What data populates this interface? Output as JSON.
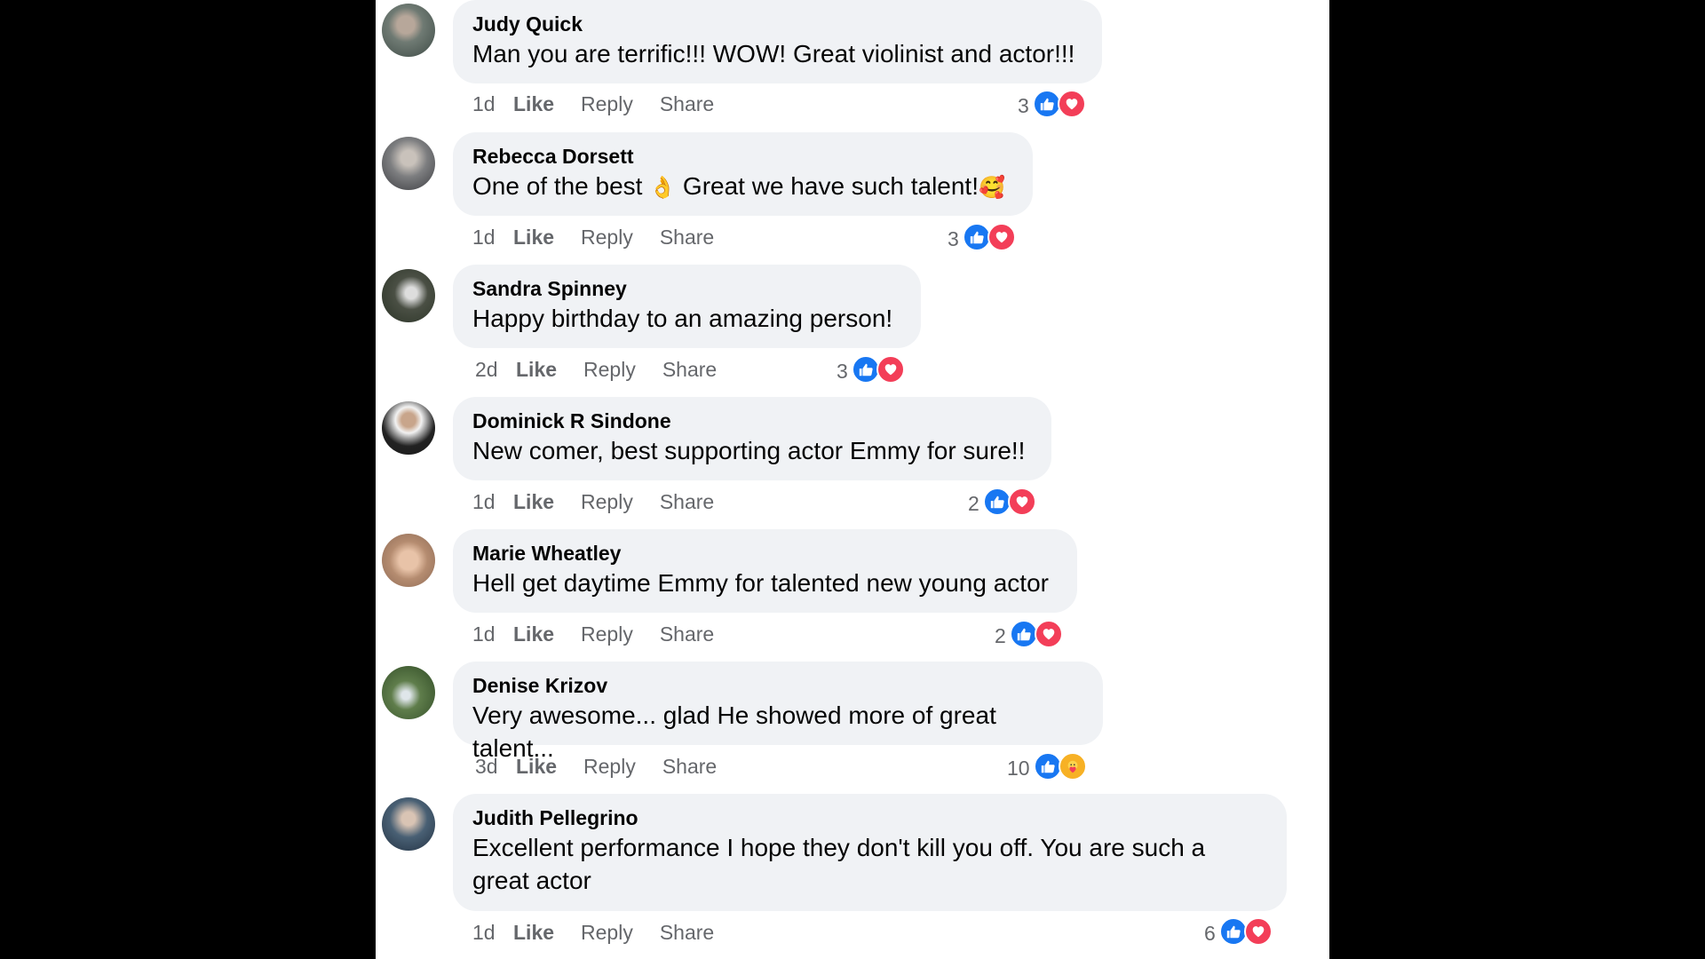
{
  "comments": [
    {
      "author": "Judy Quick",
      "text": "Man you are terrific!!! WOW! Great violinist and actor!!!",
      "emoji": "",
      "emoji2": "",
      "time": "1d",
      "count": "3",
      "reactions": [
        "like",
        "love"
      ]
    },
    {
      "author": "Rebecca Dorsett",
      "text": "One of the best ",
      "emoji": "👌",
      "text2": " Great we have such talent!",
      "emoji2": "🥰",
      "time": "1d",
      "count": "3",
      "reactions": [
        "like",
        "love"
      ]
    },
    {
      "author": "Sandra Spinney",
      "text": "Happy birthday to an amazing person!",
      "emoji": "",
      "emoji2": "",
      "time": "2d",
      "count": "3",
      "reactions": [
        "like",
        "love"
      ]
    },
    {
      "author": "Dominick R Sindone",
      "text": "New comer, best supporting actor Emmy for sure!!",
      "emoji": "",
      "emoji2": "",
      "time": "1d",
      "count": "2",
      "reactions": [
        "like",
        "love"
      ]
    },
    {
      "author": "Marie Wheatley",
      "text": "Hell get daytime Emmy for talented new young actor",
      "emoji": "",
      "emoji2": "",
      "time": "1d",
      "count": "2",
      "reactions": [
        "like",
        "love"
      ]
    },
    {
      "author": "Denise Krizov",
      "text": "Very awesome... glad He showed more of great talent...",
      "emoji": "",
      "emoji2": "",
      "time": "3d",
      "count": "10",
      "reactions": [
        "like",
        "care"
      ]
    },
    {
      "author": "Judith Pellegrino",
      "text": "Excellent performance I hope they don't kill you off. You are such a great actor",
      "emoji": "",
      "emoji2": "",
      "time": "1d",
      "count": "6",
      "reactions": [
        "like",
        "love"
      ]
    }
  ],
  "actions": {
    "like": "Like",
    "reply": "Reply",
    "share": "Share"
  },
  "colors": {
    "like": "#1877f2",
    "love": "#f33e58",
    "care": "#f7b125",
    "bubble": "#f0f2f5",
    "meta": "#65676b"
  }
}
